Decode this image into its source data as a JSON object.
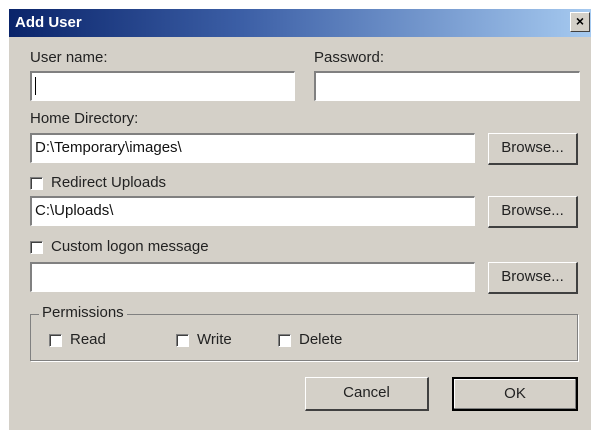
{
  "window": {
    "title": "Add User",
    "close_glyph": "×"
  },
  "form": {
    "username": {
      "label": "User name:",
      "value": ""
    },
    "password": {
      "label": "Password:",
      "value": ""
    },
    "home_directory": {
      "label": "Home Directory:",
      "value": "D:\\Temporary\\images\\",
      "browse_label": "Browse..."
    },
    "redirect_uploads": {
      "label": "Redirect Uploads",
      "checked": false,
      "value": "C:\\Uploads\\",
      "browse_label": "Browse..."
    },
    "custom_logon": {
      "label": "Custom logon message",
      "checked": false,
      "value": "",
      "browse_label": "Browse..."
    },
    "permissions": {
      "legend": "Permissions",
      "items": [
        {
          "label": "Read",
          "checked": false
        },
        {
          "label": "Write",
          "checked": false
        },
        {
          "label": "Delete",
          "checked": false
        }
      ]
    }
  },
  "buttons": {
    "cancel_label": "Cancel",
    "ok_label": "OK"
  }
}
